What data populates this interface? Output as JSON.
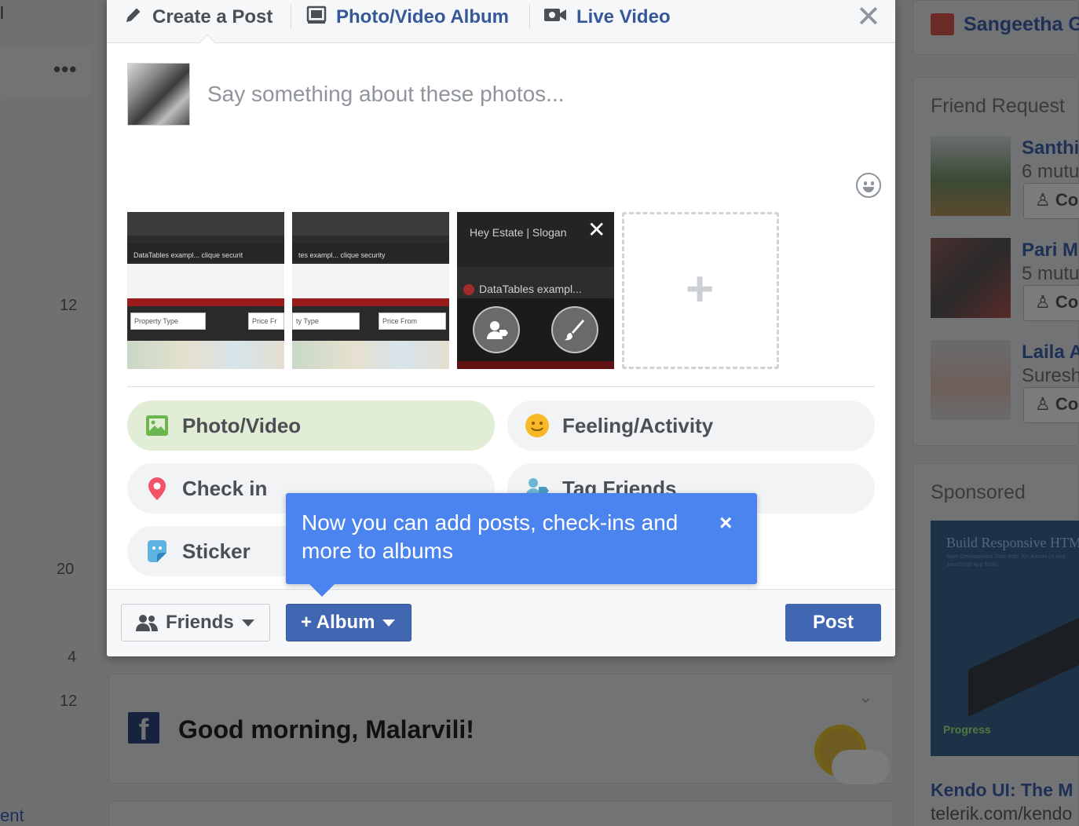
{
  "background": {
    "left_edge_text": "l",
    "left_numbers": [
      "12",
      "20",
      "4",
      "12"
    ],
    "left_bottom_text": "ent",
    "greeting": {
      "text": "Good morning, Malarvili!",
      "logo_letter": "f"
    },
    "right": {
      "birthday_name": "Sangeetha G",
      "friend_requests": {
        "title": "Friend Request",
        "items": [
          {
            "name": "Santhi",
            "sub": "6 mutu",
            "button": "Co"
          },
          {
            "name": "Pari M",
            "sub": "5 mutu",
            "button": "Co"
          },
          {
            "name": "Laila A",
            "sub": "Suresh",
            "button": "Co"
          }
        ]
      },
      "sponsored": {
        "title": "Sponsored",
        "ad_headline": "Build Responsive HTM",
        "ad_subtext": "Save Development Time With 70+ Kendo UI And JavaScript App Tools",
        "ad_brand": "Progress",
        "ad_title": "Kendo UI: The M",
        "ad_url": "telerik.com/kendo"
      }
    }
  },
  "modal": {
    "tabs": [
      {
        "label": "Create a Post",
        "icon": "pencil-icon"
      },
      {
        "label": "Photo/Video Album",
        "icon": "album-icon"
      },
      {
        "label": "Live Video",
        "icon": "video-camera-icon"
      }
    ],
    "composer": {
      "placeholder": "Say something about these photos...",
      "value": ""
    },
    "thumbnails": [
      {
        "tab_text": "DataTables exampl...  clique securit",
        "select": "Property Type",
        "select2": "Price Fr"
      },
      {
        "tab_text": "tes exampl...  clique security",
        "select": "ty Type",
        "select2": "Price From"
      },
      {
        "header": "Hey Estate | Slogan",
        "tab_text": "DataTables exampl..."
      }
    ],
    "actions": [
      {
        "label": "Photo/Video",
        "icon": "photo-icon"
      },
      {
        "label": "Feeling/Activity",
        "icon": "smiley-icon"
      },
      {
        "label": "Check in",
        "icon": "location-pin-icon"
      },
      {
        "label": "Tag Friends",
        "icon": "tag-friends-icon"
      },
      {
        "label": "Sticker",
        "icon": "sticker-icon"
      }
    ],
    "footer": {
      "audience_label": "Friends",
      "album_label": "+ Album",
      "post_label": "Post"
    },
    "tooltip": {
      "text": "Now you can add posts, check-ins and more to albums",
      "close": "×"
    }
  },
  "colors": {
    "accent": "#4267b2",
    "link": "#365899",
    "tooltip": "#4c84ef",
    "photo_pill": "#e1eed5"
  }
}
